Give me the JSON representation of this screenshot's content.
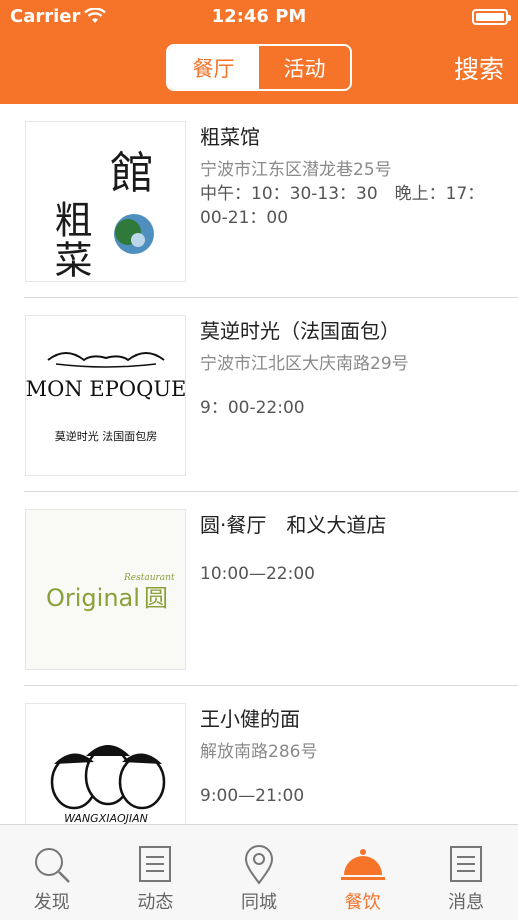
{
  "status_bar": {
    "carrier": "Carrier",
    "time": "12:46 PM"
  },
  "header": {
    "segments": [
      {
        "label": "餐厅",
        "active": true
      },
      {
        "label": "活动",
        "active": false
      }
    ],
    "search_label": "搜索",
    "accent_color": "#f6732a"
  },
  "restaurants": [
    {
      "name": "粗菜馆",
      "address": "宁波市江东区潜龙巷25号",
      "hours": "中午：10：30-13：30　晚上：17：00-21：00",
      "logo": {
        "text_a": "粗菜",
        "text_b": "館",
        "caption": ""
      }
    },
    {
      "name": "莫逆时光（法国面包）",
      "address": "宁波市江北区大庆南路29号",
      "hours": "9：00-22:00",
      "logo": {
        "text_a": "MON EPOQUE",
        "caption": "莫逆时光 法国面包房"
      }
    },
    {
      "name": "圆·餐厅　和义大道店",
      "address": "",
      "hours": "10:00—22:00",
      "logo": {
        "text_a": "Original",
        "text_b": "圆",
        "caption": "Restaurant"
      }
    },
    {
      "name": "王小健的面",
      "address": "解放南路286号",
      "hours": "9:00—21:00",
      "logo": {
        "text_a": "WANGXIAOJIAN",
        "caption": ""
      }
    }
  ],
  "tabbar": [
    {
      "label": "发现",
      "icon": "search-icon",
      "active": false
    },
    {
      "label": "动态",
      "icon": "document-icon",
      "active": false
    },
    {
      "label": "同城",
      "icon": "location-pin-icon",
      "active": false
    },
    {
      "label": "餐饮",
      "icon": "food-cloche-icon",
      "active": true
    },
    {
      "label": "消息",
      "icon": "message-list-icon",
      "active": false
    }
  ]
}
